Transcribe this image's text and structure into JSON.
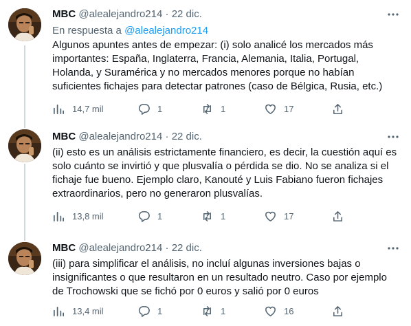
{
  "tweets": [
    {
      "name": "MBC",
      "handle": "@alealejandro214",
      "dot": "·",
      "date": "22 dic.",
      "reply_prefix": "En respuesta a",
      "reply_handle": "@alealejandro214",
      "text": "Algunos apuntes antes de empezar: (i) solo analicé los mercados más\nimportantes: España, Inglaterra, Francia, Alemania, Italia, Portugal,\nHolanda, y Suramérica y no mercados menores porque no habían\nsuficientes fichajes para detectar patrones (caso de Bélgica, Rusia, etc.)",
      "views": "14,7 mil",
      "replies": "1",
      "retweets": "1",
      "likes": "17"
    },
    {
      "name": "MBC",
      "handle": "@alealejandro214",
      "dot": "·",
      "date": "22 dic.",
      "text": "(ii) esto es un análisis estrictamente financiero, es decir, la cuestión aquí es\nsolo cuánto se invirtió y que plusvalía o pérdida se dio. No se analiza si el\nfichaje fue bueno. Ejemplo claro, Kanouté y Luis Fabiano fueron fichajes\nextraordinarios, pero no generaron plusvalías.",
      "views": "13,8 mil",
      "replies": "1",
      "retweets": "1",
      "likes": "17"
    },
    {
      "name": "MBC",
      "handle": "@alealejandro214",
      "dot": "·",
      "date": "22 dic.",
      "text": "(iii) para simplificar el análisis, no incluí algunas inversiones bajas o\ninsignificantes o que resultaron en un resultado neutro. Caso por ejemplo\nde Trochowski que se fichó por 0 euros y salió por 0 euros",
      "views": "13,4 mil",
      "replies": "1",
      "retweets": "1",
      "likes": "16"
    }
  ],
  "icons": {
    "more": "more-icon",
    "views": "analytics-icon",
    "reply": "reply-icon",
    "retweet": "retweet-icon",
    "like": "heart-icon",
    "share": "share-icon"
  },
  "colors": {
    "text": "#0f1419",
    "secondary": "#536471",
    "link": "#1d9bf0",
    "thread_line": "#cfd9de"
  }
}
